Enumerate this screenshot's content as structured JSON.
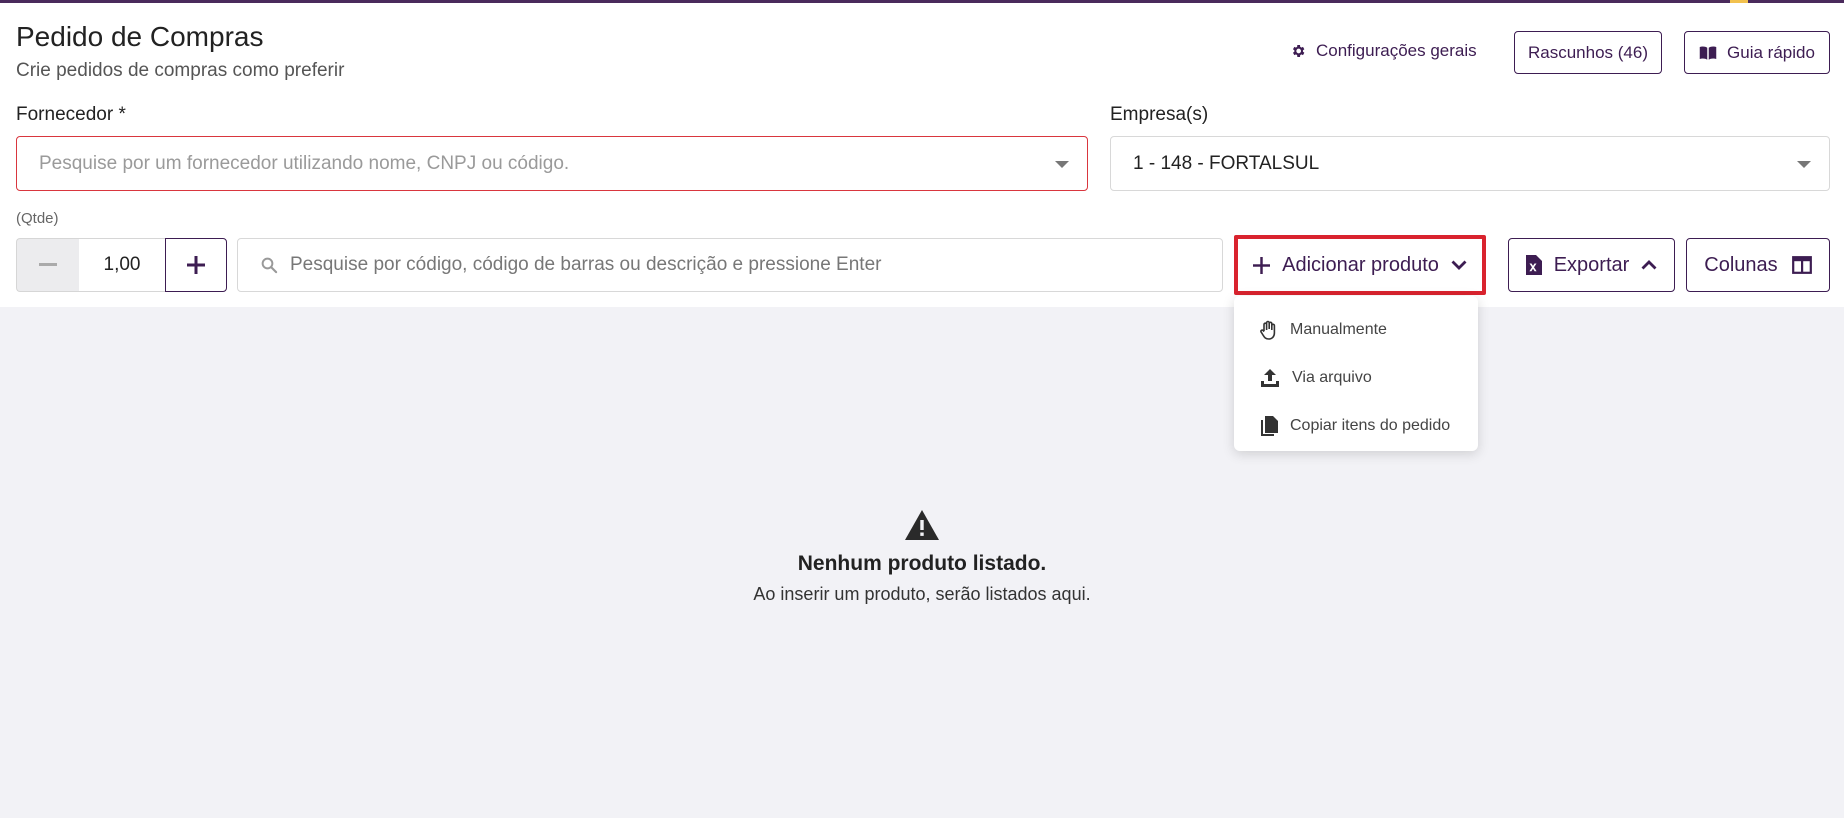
{
  "page": {
    "title": "Pedido de Compras",
    "subtitle": "Crie pedidos de compras como preferir"
  },
  "header_actions": {
    "settings_label": "Configurações gerais",
    "drafts_label": "Rascunhos (46)",
    "guide_label": "Guia rápido"
  },
  "supplier": {
    "label": "Fornecedor *",
    "placeholder": "Pesquise por um fornecedor utilizando nome, CNPJ ou código."
  },
  "company": {
    "label": "Empresa(s)",
    "value": "1 - 148 - FORTALSUL"
  },
  "quantity": {
    "label": "(Qtde)",
    "value": "1,00"
  },
  "product_search": {
    "placeholder": "Pesquise por código, código de barras ou descrição e pressione Enter"
  },
  "toolbar": {
    "add_product_label": "Adicionar produto",
    "export_label": "Exportar",
    "columns_label": "Colunas"
  },
  "add_menu": {
    "items": [
      {
        "label": "Manualmente",
        "icon": "hand-icon"
      },
      {
        "label": "Via arquivo",
        "icon": "upload-icon"
      },
      {
        "label": "Copiar itens do pedido",
        "icon": "copy-icon"
      }
    ]
  },
  "empty_state": {
    "icon": "warning-icon",
    "title": "Nenhum produto listado.",
    "message": "Ao inserir um produto, serão listados aqui."
  },
  "colors": {
    "brand": "#3d1d52",
    "error": "#d9363e",
    "highlight": "#d9232e"
  }
}
